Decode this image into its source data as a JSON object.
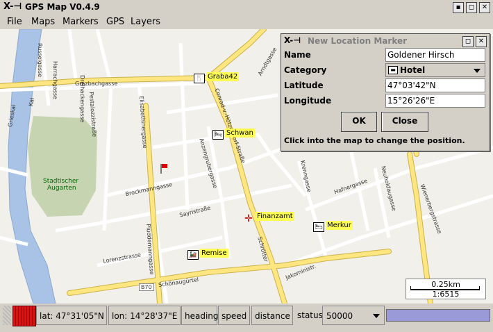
{
  "window": {
    "logo": "X-⊣",
    "title": "GPS Map V0.4.9",
    "buttons": [
      "▪",
      "◻",
      "✕"
    ]
  },
  "menu": {
    "file": "File",
    "maps": "Maps",
    "markers": "Markers",
    "gps": "GPS",
    "layers": "Layers"
  },
  "map": {
    "park_label_1": "Stadtischer",
    "park_label_2": "Augarten",
    "streets": {
      "grazbachgasse": "Grazbachgasse",
      "brockmanngasse": "Brockmanngasse",
      "sayristrasse": "Sayristraße",
      "lorenzstrasse": "Lorenzstrasse",
      "schonaugurtel": "Schönaugürtel",
      "harrachgasse": "Harrachgasse",
      "russelgasse": "Russelgasse",
      "dreihackengasse": "Dreihackengasse",
      "jakoministrasse": "Jakoministr.",
      "conrad": "Conrad-v.-Hötzendorf-Straße",
      "annenstrasse": "Anzengrubergasse",
      "hafnergasse": "Hafnergasse",
      "schrotterstrasse": "Schrötter",
      "kai": "Kai",
      "grieskai": "Grieskai",
      "elisabethinergasse": "Elisabethinergasse",
      "pestalozzi": "Pestalozzistraße",
      "plueddemanngasse": "Plüddemanngasse",
      "b70": "B70",
      "weinberggasse": "Wienerbergstrasse",
      "neuholdaugasse": "Neuholdaugasse",
      "krenngasse": "Krenngasse",
      "amgrazbach": "Arndtgasse"
    },
    "markers": [
      {
        "name": "Graba42",
        "icon": "restaurant-icon",
        "glyph": "🍴"
      },
      {
        "name": "Schwan",
        "icon": "hotel-icon",
        "glyph": "🛏"
      },
      {
        "name": "Finanzamt",
        "icon": "office-icon",
        "glyph": "✛"
      },
      {
        "name": "Merkur",
        "icon": "hotel-icon",
        "glyph": "🛏"
      },
      {
        "name": "Remise",
        "icon": "train-icon",
        "glyph": "🚂"
      }
    ],
    "scale": {
      "distance": "0.25km",
      "ratio": "1:6515"
    }
  },
  "status": {
    "lat": "lat: 47°31'05\"N",
    "lon": "lon: 14°28'37\"E",
    "heading": "heading",
    "speed": "speed",
    "distance": "distance",
    "status": "status",
    "zoom": "50000",
    "progress_fraction": 1.0
  },
  "dialog": {
    "logo": "X-⊣",
    "title": "New Location Marker",
    "name_label": "Name",
    "name_value": "Goldener Hirsch",
    "category_label": "Category",
    "category_value": "Hotel",
    "latitude_label": "Latitude",
    "latitude_value": "47°03'42\"N",
    "longitude_label": "Longitude",
    "longitude_value": "15°26'26\"E",
    "ok": "OK",
    "close": "Close",
    "hint": "Click into the map to change the position."
  },
  "colors": {
    "road_major": "#ffe680",
    "river": "#a9c3e6",
    "park": "#c7d4b2",
    "highlight": "#ffff55"
  }
}
